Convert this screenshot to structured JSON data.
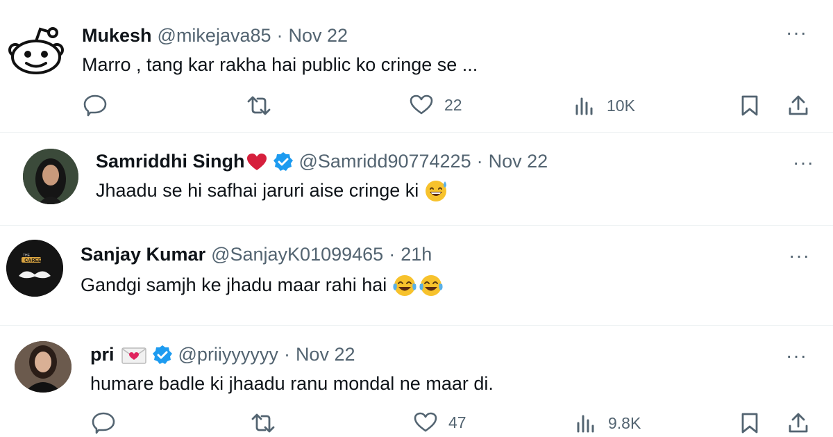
{
  "tweets": [
    {
      "name": "Mukesh",
      "handle": "@mikejava85",
      "separator": "·",
      "time": "Nov 22",
      "text": "Marro ,  tang kar rakha hai public ko cringe se ...",
      "avatar_icon": "reddit-alien-icon",
      "metrics": {
        "likes": "22",
        "views": "10K"
      }
    },
    {
      "name": "Samriddhi Singh",
      "handle": "@Samridd90774225",
      "separator": "·",
      "time": "Nov 22",
      "text": "Jhaadu se hi safhai jaruri aise cringe ki",
      "name_icon": "red-heart-icon",
      "verified": true,
      "text_emoji": "grinning-face-with-sweat-icon"
    },
    {
      "name": "Sanjay Kumar",
      "handle": "@SanjayK01099465",
      "separator": "·",
      "time": "21h",
      "text": "Gandgi samjh ke jhadu maar rahi hai",
      "text_emoji": "face-with-tears-of-joy-icon",
      "avatar_caption": "THE CAREER"
    },
    {
      "name": "pri",
      "handle": "@priiyyyyyy",
      "separator": "·",
      "time": "Nov 22",
      "text": "humare badle ki jhaadu ranu mondal ne maar di.",
      "name_icon": "love-letter-icon",
      "verified": true,
      "metrics": {
        "likes": "47",
        "views": "9.8K"
      }
    }
  ],
  "more_label": "···",
  "colors": {
    "text": "#0f1419",
    "secondary": "#536471",
    "verified": "#1d9bf0",
    "heart": "#e0245e",
    "divider": "#eff3f4"
  }
}
